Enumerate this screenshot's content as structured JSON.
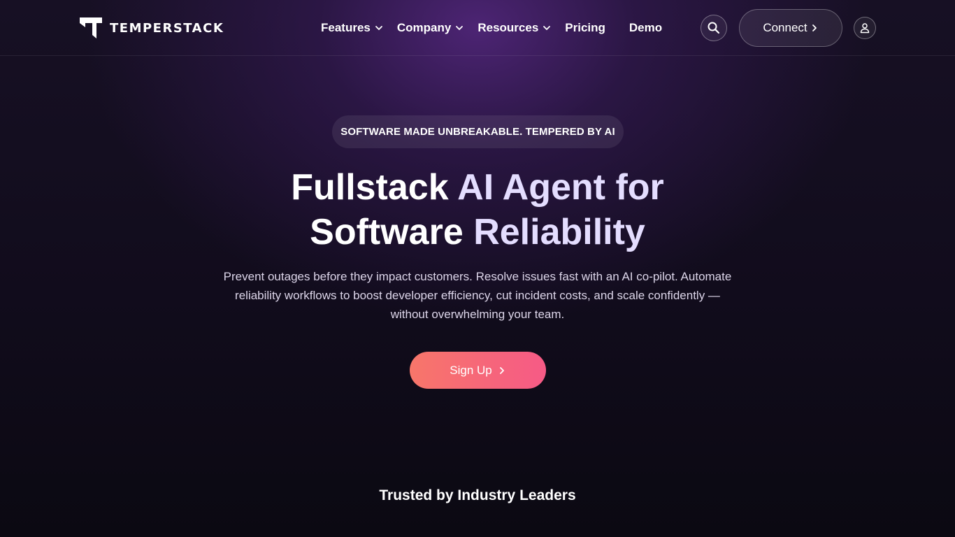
{
  "brand": {
    "name": "TEMPERSTACK"
  },
  "nav": {
    "items": [
      {
        "label": "Features",
        "has_dropdown": true
      },
      {
        "label": "Company",
        "has_dropdown": true
      },
      {
        "label": "Resources",
        "has_dropdown": true
      },
      {
        "label": "Pricing",
        "has_dropdown": false
      },
      {
        "label": "Demo",
        "has_dropdown": false
      }
    ],
    "search_icon": "search-icon",
    "connect_label": "Connect",
    "user_icon": "user-icon"
  },
  "hero": {
    "badge": "SOFTWARE MADE UNBREAKABLE. TEMPERED BY AI",
    "headline_line1_plain": "Fullstack ",
    "headline_line1_accent": "AI Agent for",
    "headline_line2_plain": "Software ",
    "headline_line2_accent": "Reliability",
    "subtext": "Prevent outages before they impact customers. Resolve issues fast with an AI co-pilot. Automate reliability workflows to boost developer efficiency, cut incident costs, and scale confidently — without overwhelming your team.",
    "cta_label": "Sign Up"
  },
  "trusted": {
    "heading": "Trusted by Industry Leaders"
  },
  "colors": {
    "background": "#0c0a14",
    "glow": "#56288a",
    "accent_text": "#e4ddff",
    "cta_gradient_start": "#f7766a",
    "cta_gradient_end": "#f65a86"
  }
}
